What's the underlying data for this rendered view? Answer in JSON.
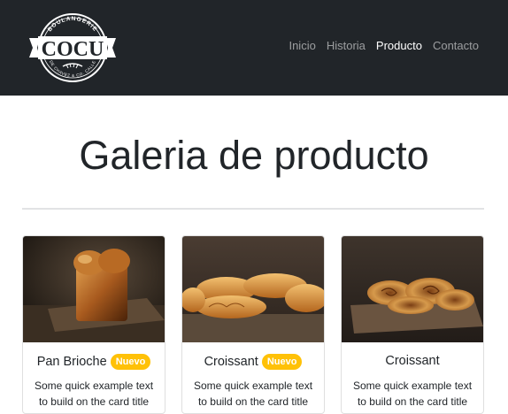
{
  "brand": {
    "logo_top_text": "BOULANGERIE",
    "logo_name": "COCU",
    "logo_bottom_text": "DE CHAVEZ & CO. CALLE"
  },
  "nav": {
    "items": [
      {
        "label": "Inicio",
        "active": false
      },
      {
        "label": "Historia",
        "active": false
      },
      {
        "label": "Producto",
        "active": true
      },
      {
        "label": "Contacto",
        "active": false
      }
    ]
  },
  "main": {
    "title": "Galeria de producto"
  },
  "cards": [
    {
      "title": "Pan Brioche",
      "badge": "Nuevo",
      "text": "Some quick example text to build on the card title",
      "image": "brioche-loaf"
    },
    {
      "title": "Croissant",
      "badge": "Nuevo",
      "text": "Some quick example text to build on the card title",
      "image": "croissants"
    },
    {
      "title": "Croissant",
      "badge": "",
      "text": "Some quick example text to build on the card title",
      "image": "cinnamon-rolls"
    }
  ],
  "colors": {
    "navbar_bg": "#212529",
    "badge_bg": "#ffc107",
    "nav_active": "#ffffff",
    "nav_inactive": "#9a9da0"
  }
}
